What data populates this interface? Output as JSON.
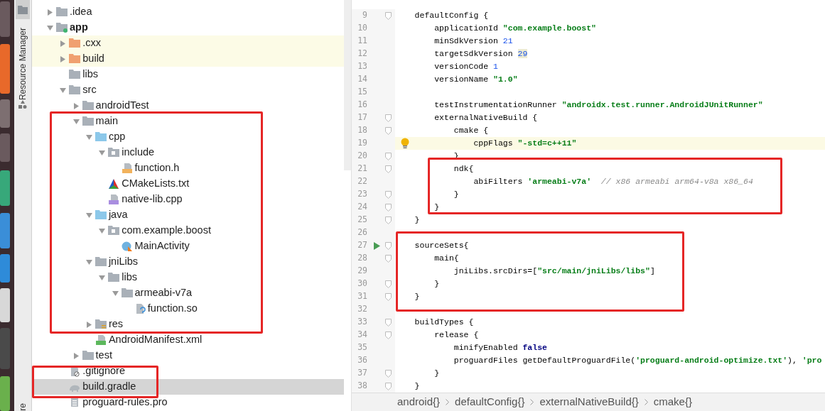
{
  "tool_strip": {
    "tool_windows": [
      {
        "label": "Resource Manager"
      },
      {
        "label": "re"
      }
    ]
  },
  "tree": [
    {
      "label": ".idea",
      "kind": "folder",
      "expanded": false,
      "selected": false
    },
    {
      "label": "app",
      "kind": "module",
      "expanded": true,
      "selected": false,
      "children": [
        {
          "label": ".cxx",
          "kind": "excluded-folder",
          "expanded": false,
          "selected": false
        },
        {
          "label": "build",
          "kind": "excluded-folder",
          "expanded": false,
          "selected": false
        },
        {
          "label": "libs",
          "kind": "folder",
          "selected": false
        },
        {
          "label": "src",
          "kind": "folder",
          "expanded": true,
          "selected": false,
          "children": [
            {
              "label": "androidTest",
              "kind": "folder",
              "expanded": false,
              "selected": false
            },
            {
              "label": "main",
              "kind": "folder",
              "expanded": true,
              "selected": false,
              "frame_start": true,
              "children": [
                {
                  "label": "cpp",
                  "kind": "source-folder",
                  "expanded": true,
                  "selected": false,
                  "children": [
                    {
                      "label": "include",
                      "kind": "package",
                      "expanded": true,
                      "selected": false,
                      "children": [
                        {
                          "label": "function.h",
                          "kind": "header",
                          "selected": false
                        }
                      ]
                    },
                    {
                      "label": "CMakeLists.txt",
                      "kind": "cmake",
                      "selected": false
                    },
                    {
                      "label": "native-lib.cpp",
                      "kind": "cpp",
                      "selected": false
                    }
                  ]
                },
                {
                  "label": "java",
                  "kind": "source-folder",
                  "expanded": true,
                  "selected": false,
                  "children": [
                    {
                      "label": "com.example.boost",
                      "kind": "package",
                      "expanded": true,
                      "selected": false,
                      "children": [
                        {
                          "label": "MainActivity",
                          "kind": "class",
                          "selected": false
                        }
                      ]
                    }
                  ]
                },
                {
                  "label": "jniLibs",
                  "kind": "folder",
                  "expanded": true,
                  "selected": false,
                  "children": [
                    {
                      "label": "libs",
                      "kind": "folder",
                      "expanded": true,
                      "selected": false,
                      "children": [
                        {
                          "label": "armeabi-v7a",
                          "kind": "folder",
                          "expanded": true,
                          "selected": false,
                          "children": [
                            {
                              "label": "function.so",
                              "kind": "unknown-file",
                              "selected": false
                            }
                          ]
                        }
                      ]
                    }
                  ]
                },
                {
                  "label": "res",
                  "kind": "resource-folder",
                  "expanded": false,
                  "selected": false,
                  "frame_end": true
                },
                {
                  "label": "AndroidManifest.xml",
                  "kind": "manifest",
                  "selected": false
                }
              ]
            },
            {
              "label": "test",
              "kind": "folder",
              "expanded": false,
              "selected": false
            }
          ]
        },
        {
          "label": ".gitignore",
          "kind": "ignore-file",
          "selected": false,
          "frame_start": true
        },
        {
          "label": "build.gradle",
          "kind": "gradle",
          "selected": true,
          "frame_end": true
        },
        {
          "label": "proguard-rules.pro",
          "kind": "text-file",
          "selected": false
        }
      ]
    }
  ],
  "editor": {
    "lines": [
      {
        "number": "9",
        "current": false,
        "fold": true,
        "tokens": [
          {
            "kind": "plain",
            "text": "    defaultConfig {"
          }
        ]
      },
      {
        "number": "10",
        "current": false,
        "tokens": [
          {
            "kind": "plain",
            "text": "        applicationId "
          },
          {
            "kind": "string",
            "text": "\"com.example.boost\""
          }
        ]
      },
      {
        "number": "11",
        "current": false,
        "tokens": [
          {
            "kind": "plain",
            "text": "        minSdkVersion "
          },
          {
            "kind": "number",
            "text": "21"
          }
        ]
      },
      {
        "number": "12",
        "current": false,
        "tokens": [
          {
            "kind": "plain",
            "text": "        targetSdkVersion "
          },
          {
            "kind": "number",
            "text": "29",
            "highlighted": true
          }
        ]
      },
      {
        "number": "13",
        "current": false,
        "tokens": [
          {
            "kind": "plain",
            "text": "        versionCode "
          },
          {
            "kind": "number",
            "text": "1"
          }
        ]
      },
      {
        "number": "14",
        "current": false,
        "tokens": [
          {
            "kind": "plain",
            "text": "        versionName "
          },
          {
            "kind": "string",
            "text": "\"1.0\""
          }
        ]
      },
      {
        "number": "15",
        "current": false
      },
      {
        "number": "16",
        "current": false,
        "tokens": [
          {
            "kind": "plain",
            "text": "        testInstrumentationRunner "
          },
          {
            "kind": "string",
            "text": "\"androidx.test.runner.AndroidJUnitRunner\""
          }
        ]
      },
      {
        "number": "17",
        "current": false,
        "fold": true,
        "tokens": [
          {
            "kind": "plain",
            "text": "        externalNativeBuild {"
          }
        ]
      },
      {
        "number": "18",
        "current": false,
        "fold": true,
        "tokens": [
          {
            "kind": "plain",
            "text": "            cmake {"
          }
        ]
      },
      {
        "number": "19",
        "current": true,
        "bulb": true,
        "tokens": [
          {
            "kind": "plain",
            "text": "                cppFlags "
          },
          {
            "kind": "string",
            "text": "\"-std=c++11\""
          }
        ]
      },
      {
        "number": "20",
        "current": false,
        "fold": true,
        "tokens": [
          {
            "kind": "plain",
            "text": "            }"
          }
        ]
      },
      {
        "number": "21",
        "current": false,
        "fold": true,
        "frame_start": true,
        "tokens": [
          {
            "kind": "plain",
            "text": "            ndk{"
          }
        ]
      },
      {
        "number": "22",
        "current": false,
        "tokens": [
          {
            "kind": "plain",
            "text": "                abiFilters "
          },
          {
            "kind": "string",
            "text": "'armeabi-v7a'"
          },
          {
            "kind": "comment",
            "text": "  // x86 armeabi arm64-v8a x86_64"
          }
        ]
      },
      {
        "number": "23",
        "current": false,
        "fold": true,
        "tokens": [
          {
            "kind": "plain",
            "text": "            }"
          }
        ]
      },
      {
        "number": "24",
        "current": false,
        "fold": true,
        "frame_end": true,
        "tokens": [
          {
            "kind": "plain",
            "text": "        }"
          }
        ]
      },
      {
        "number": "25",
        "current": false,
        "fold": true,
        "tokens": [
          {
            "kind": "plain",
            "text": "    }"
          }
        ]
      },
      {
        "number": "26",
        "current": false
      },
      {
        "number": "27",
        "current": false,
        "fold": true,
        "run": true,
        "frame_start": true,
        "tokens": [
          {
            "kind": "plain",
            "text": "    sourceSets{"
          }
        ]
      },
      {
        "number": "28",
        "current": false,
        "fold": true,
        "tokens": [
          {
            "kind": "plain",
            "text": "        main{"
          }
        ]
      },
      {
        "number": "29",
        "current": false,
        "tokens": [
          {
            "kind": "plain",
            "text": "            jniLibs.srcDirs=["
          },
          {
            "kind": "string",
            "text": "\"src/main/jniLibs/libs\""
          },
          {
            "kind": "plain",
            "text": "]"
          }
        ]
      },
      {
        "number": "30",
        "current": false,
        "fold": true,
        "tokens": [
          {
            "kind": "plain",
            "text": "        }"
          }
        ]
      },
      {
        "number": "31",
        "current": false,
        "fold": true,
        "frame_end": true,
        "tokens": [
          {
            "kind": "plain",
            "text": "    }"
          }
        ]
      },
      {
        "number": "32",
        "current": false
      },
      {
        "number": "33",
        "current": false,
        "fold": true,
        "tokens": [
          {
            "kind": "plain",
            "text": "    buildTypes {"
          }
        ]
      },
      {
        "number": "34",
        "current": false,
        "fold": true,
        "tokens": [
          {
            "kind": "plain",
            "text": "        release {"
          }
        ]
      },
      {
        "number": "35",
        "current": false,
        "tokens": [
          {
            "kind": "plain",
            "text": "            minifyEnabled "
          },
          {
            "kind": "keyword",
            "text": "false"
          }
        ]
      },
      {
        "number": "36",
        "current": false,
        "tokens": [
          {
            "kind": "plain",
            "text": "            proguardFiles getDefaultProguardFile("
          },
          {
            "kind": "string",
            "text": "'proguard-android-optimize.txt'"
          },
          {
            "kind": "plain",
            "text": "), "
          },
          {
            "kind": "string",
            "text": "'pro"
          }
        ]
      },
      {
        "number": "37",
        "current": false,
        "fold": true,
        "tokens": [
          {
            "kind": "plain",
            "text": "        }"
          }
        ]
      },
      {
        "number": "38",
        "current": false,
        "fold": true,
        "tokens": [
          {
            "kind": "plain",
            "text": "    }"
          }
        ]
      }
    ]
  },
  "breadcrumb": [
    "android{}",
    "defaultConfig{}",
    "externalNativeBuild{}",
    "cmake{}"
  ]
}
